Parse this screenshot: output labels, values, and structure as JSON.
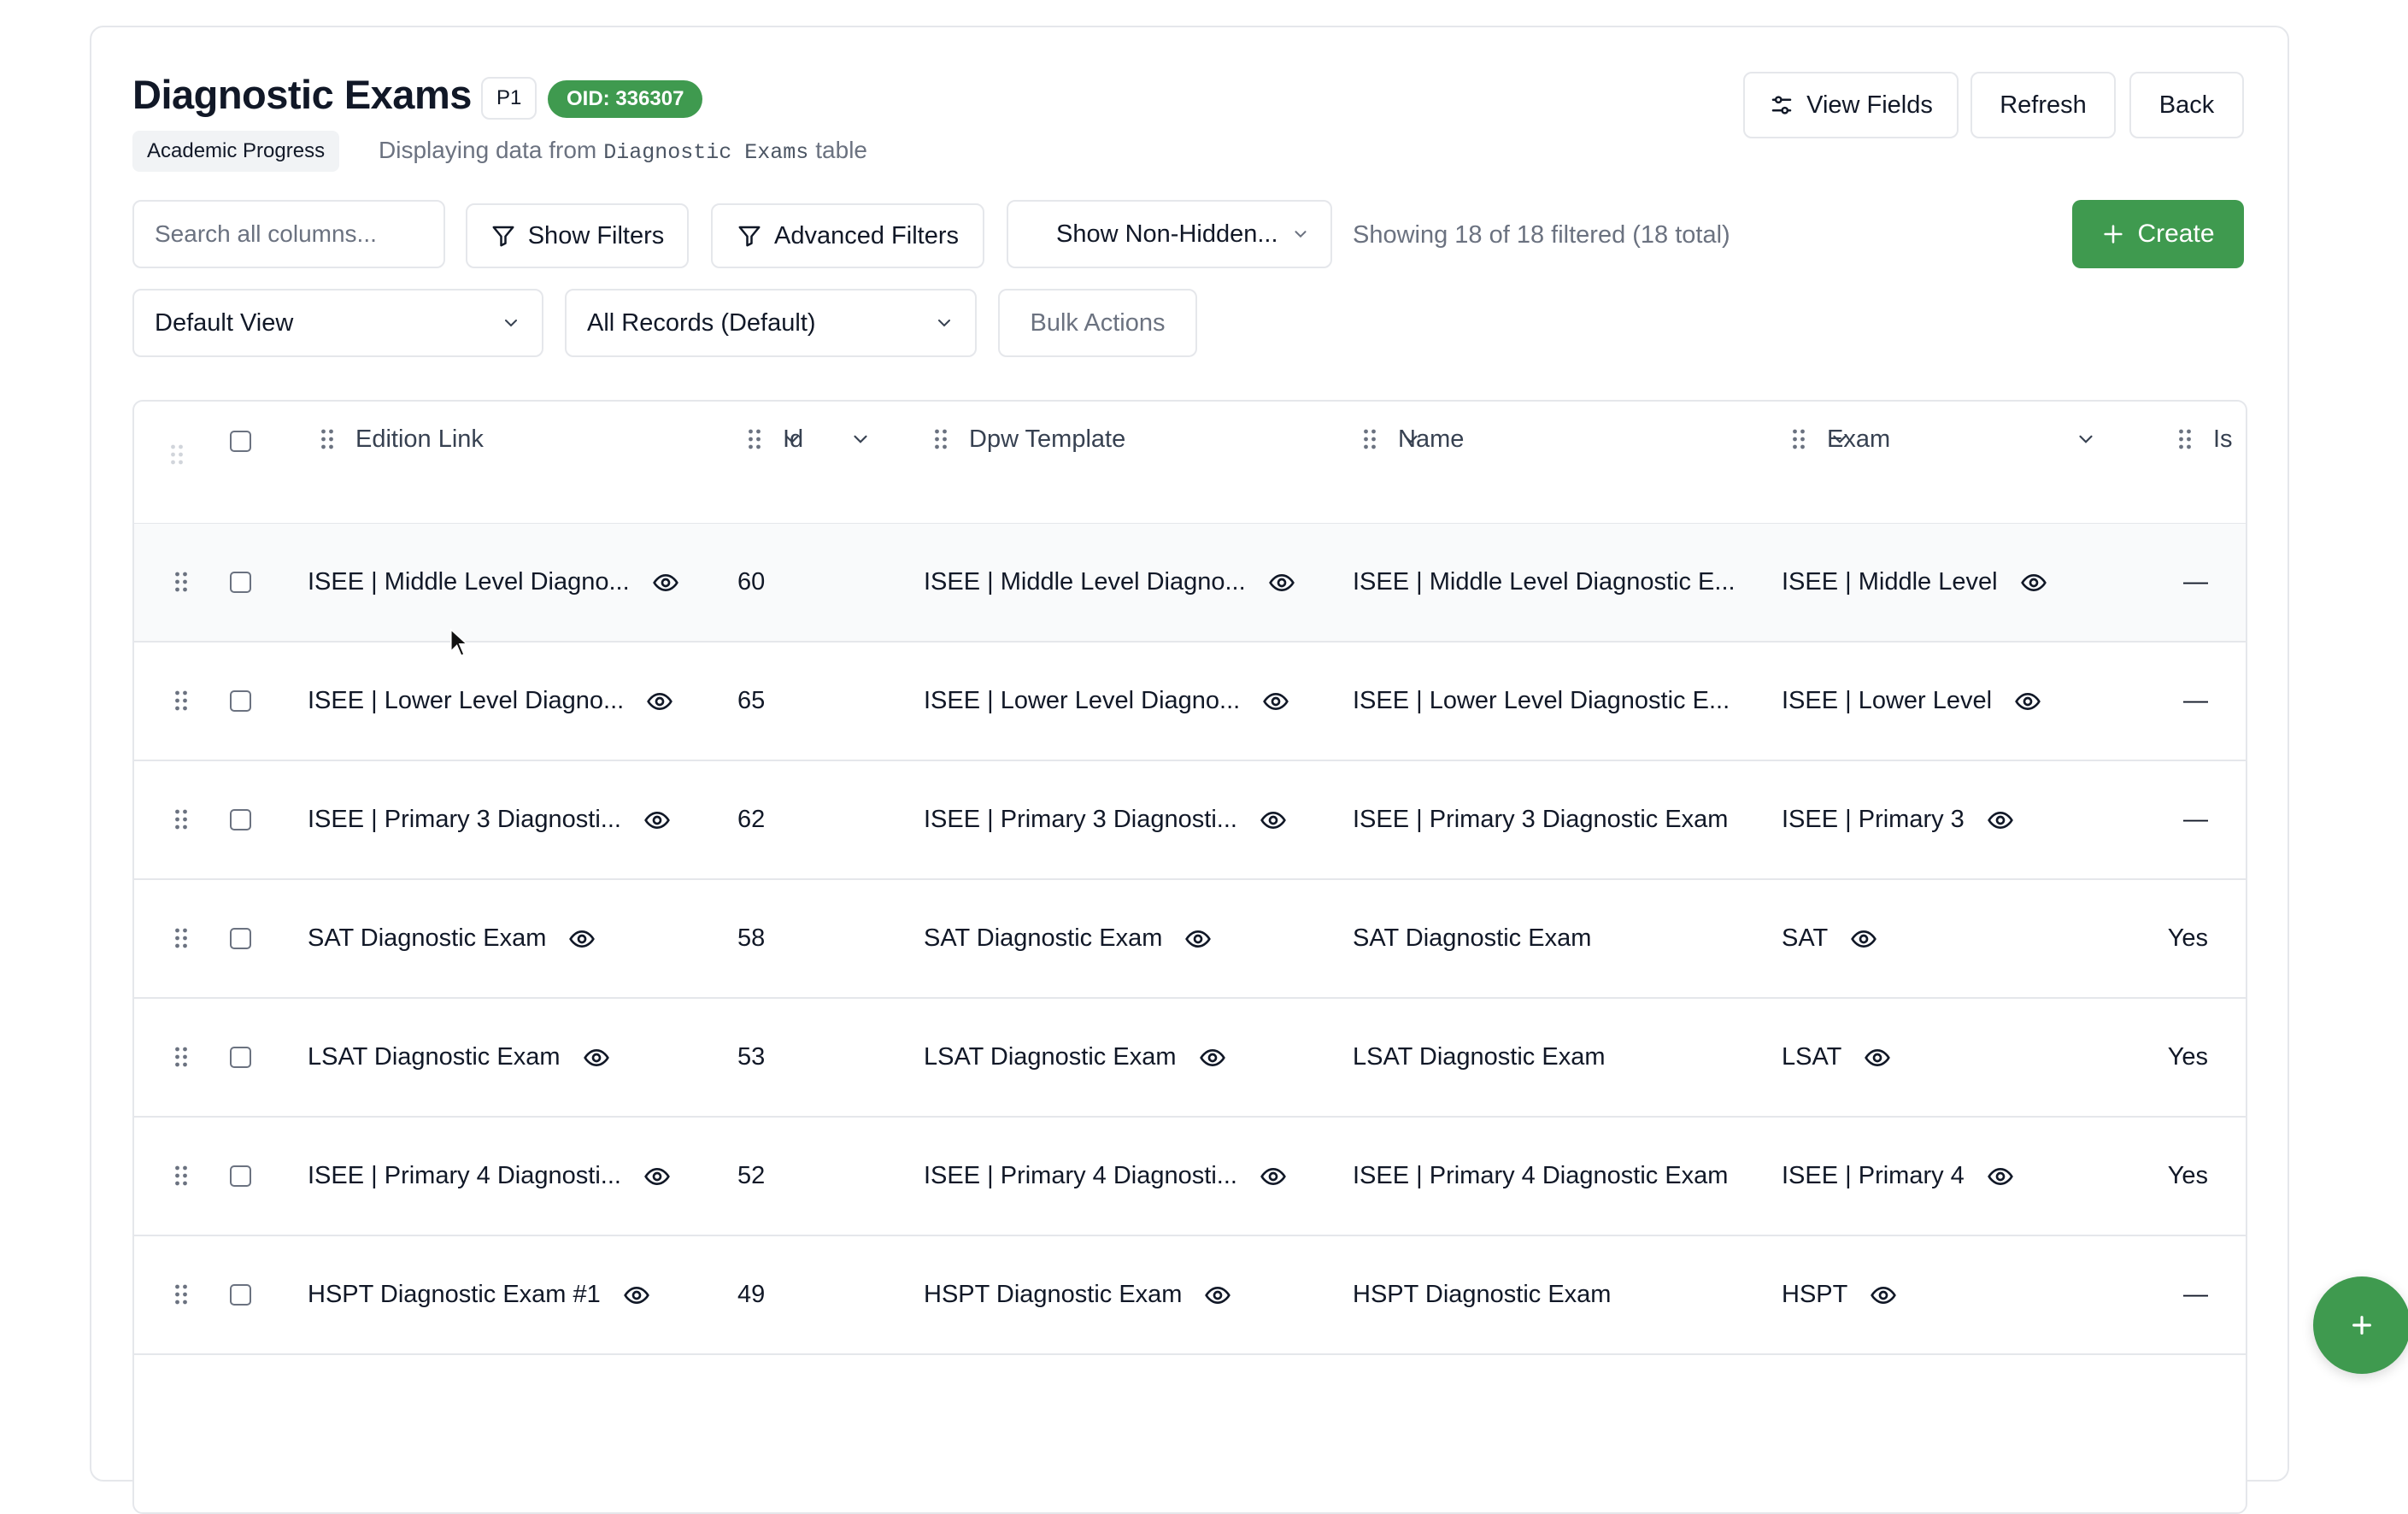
{
  "header": {
    "title": "Diagnostic Exams",
    "priority_badge": "P1",
    "oid_badge": "OID: 336307",
    "category_badge": "Academic Progress",
    "subtitle_prefix": "Displaying data from",
    "subtitle_table": "Diagnostic Exams",
    "subtitle_suffix": "table"
  },
  "actions": {
    "view_fields": "View Fields",
    "refresh": "Refresh",
    "back": "Back"
  },
  "toolbar": {
    "search_placeholder": "Search all columns...",
    "show_filters": "Show Filters",
    "advanced_filters": "Advanced Filters",
    "visibility_select": "Show Non-Hidden...",
    "count_text": "Showing 18 of 18 filtered (18 total)",
    "create": "Create",
    "view_select": "Default View",
    "records_select": "All Records (Default)",
    "bulk_actions": "Bulk Actions"
  },
  "table": {
    "columns": [
      "Edition Link",
      "Id",
      "Dpw Template",
      "Name",
      "Exam",
      "Is"
    ],
    "rows": [
      {
        "edition_link": "ISEE | Middle Level Diagno...",
        "id": "60",
        "dpw_template": "ISEE | Middle Level Diagno...",
        "name": "ISEE | Middle Level Diagnostic E...",
        "exam": "ISEE | Middle Level",
        "is": "—"
      },
      {
        "edition_link": "ISEE | Lower Level Diagno...",
        "id": "65",
        "dpw_template": "ISEE | Lower Level Diagno...",
        "name": "ISEE | Lower Level Diagnostic E...",
        "exam": "ISEE | Lower Level",
        "is": "—"
      },
      {
        "edition_link": "ISEE | Primary 3 Diagnosti...",
        "id": "62",
        "dpw_template": "ISEE | Primary 3 Diagnosti...",
        "name": "ISEE | Primary 3 Diagnostic Exam",
        "exam": "ISEE | Primary 3",
        "is": "—"
      },
      {
        "edition_link": "SAT Diagnostic Exam",
        "id": "58",
        "dpw_template": "SAT Diagnostic Exam",
        "name": "SAT Diagnostic Exam",
        "exam": "SAT",
        "is": "Yes"
      },
      {
        "edition_link": "LSAT Diagnostic Exam",
        "id": "53",
        "dpw_template": "LSAT Diagnostic Exam",
        "name": "LSAT Diagnostic Exam",
        "exam": "LSAT",
        "is": "Yes"
      },
      {
        "edition_link": "ISEE | Primary 4 Diagnosti...",
        "id": "52",
        "dpw_template": "ISEE | Primary 4 Diagnosti...",
        "name": "ISEE | Primary 4 Diagnostic Exam",
        "exam": "ISEE | Primary 4",
        "is": "Yes"
      },
      {
        "edition_link": "HSPT Diagnostic Exam #1",
        "id": "49",
        "dpw_template": "HSPT Diagnostic Exam",
        "name": "HSPT Diagnostic Exam",
        "exam": "HSPT",
        "is": "—"
      }
    ]
  },
  "colors": {
    "accent_green": "#3f9a4f",
    "border": "#e5e7eb",
    "muted_text": "#6b7280"
  }
}
